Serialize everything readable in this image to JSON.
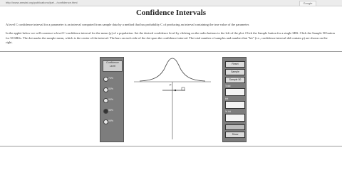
{
  "browser": {
    "url": "http://www.amstat.org/publications/jse/.../confidence.html",
    "tab_label": "Google"
  },
  "page": {
    "title": "Confidence Intervals",
    "intro": "A level C confidence interval for a parameter is an interval computed from sample data by a method that has probability C of producing an interval containing the true value of the parameter.",
    "instructions": "In the applet below we will construct a level C confidence interval for the mean (μ) of a population. Set the desired confidence level by clicking on the radio buttons to the left of the plot. Click the Sample button for a single SRS. Click the Sample 50 button for 50 SRSs. The dot marks the sample mean, which is the center of the interval. The bars on each side of the dot span the confidence interval. The total number of samples and number that \"hit\" (i.e., confidence interval did contain μ) are shown on the right."
  },
  "applet": {
    "left_panel": {
      "heading": "Confidence Level",
      "levels": [
        "70%",
        "80%",
        "90%",
        "95%",
        "99%"
      ],
      "selected_index": 3
    },
    "right_panel": {
      "buttons": {
        "reset": "Reset",
        "sample": "Sample",
        "sample50": "Sample 50",
        "show": "Show"
      },
      "fields": {
        "total_label": "Total",
        "hit_label": "Hit",
        "percent_label": "% hit"
      }
    },
    "plot": {
      "mu_label": "μ",
      "curve_type": "normal"
    }
  }
}
